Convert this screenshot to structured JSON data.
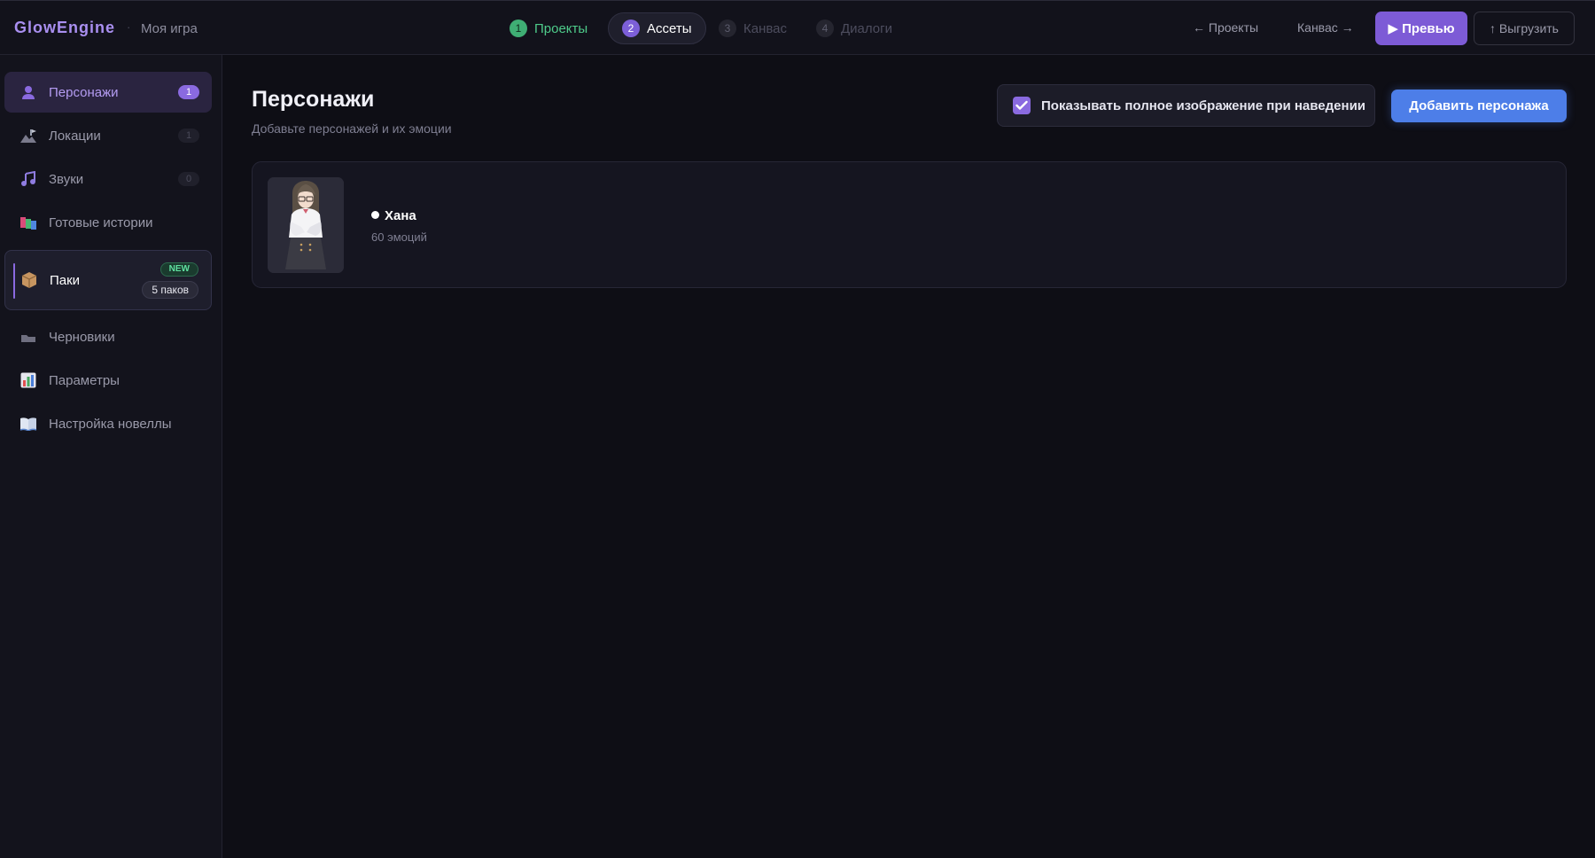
{
  "header": {
    "brand": "GlowEngine",
    "separator": "·",
    "project_name": "Моя игра",
    "steps": [
      {
        "num": "1",
        "label": "Проекты",
        "state": "done"
      },
      {
        "num": "2",
        "label": "Ассеты",
        "state": "active"
      },
      {
        "num": "3",
        "label": "Канвас",
        "state": "todo"
      },
      {
        "num": "4",
        "label": "Диалоги",
        "state": "todo"
      }
    ],
    "back_link": "← Проекты",
    "forward_link": "Канвас →",
    "preview_label": "▶ Превью",
    "export_label": "↑ Выгрузить"
  },
  "sidebar": {
    "items": [
      {
        "label": "Персонажи",
        "count": "1",
        "icon": "user-icon",
        "active": true
      },
      {
        "label": "Локации",
        "count": "1",
        "icon": "location-icon"
      },
      {
        "label": "Звуки",
        "count": "0",
        "icon": "music-icon"
      },
      {
        "label": "Готовые истории",
        "icon": "stories-icon"
      },
      {
        "label": "Паки",
        "badge": "NEW",
        "sub_badge": "5 паков",
        "icon": "package-icon"
      },
      {
        "label": "Черновики",
        "icon": "drafts-icon"
      },
      {
        "label": "Параметры",
        "icon": "chart-icon"
      },
      {
        "label": "Настройка новеллы",
        "icon": "book-icon"
      }
    ]
  },
  "main": {
    "title": "Персонажи",
    "subtitle": "Добавьте персонажей и их эмоции",
    "hover_toggle": {
      "label": "Показывать полное изображение при наведении",
      "checked": true
    },
    "add_button": "Добавить персонажа",
    "characters": [
      {
        "name": "Хана",
        "emotions": "60 эмоций"
      }
    ]
  },
  "colors": {
    "accent": "#7d5bd6",
    "primary_blue": "#4d7ee8",
    "success": "#4ecb8a",
    "background": "#0e0e15"
  }
}
